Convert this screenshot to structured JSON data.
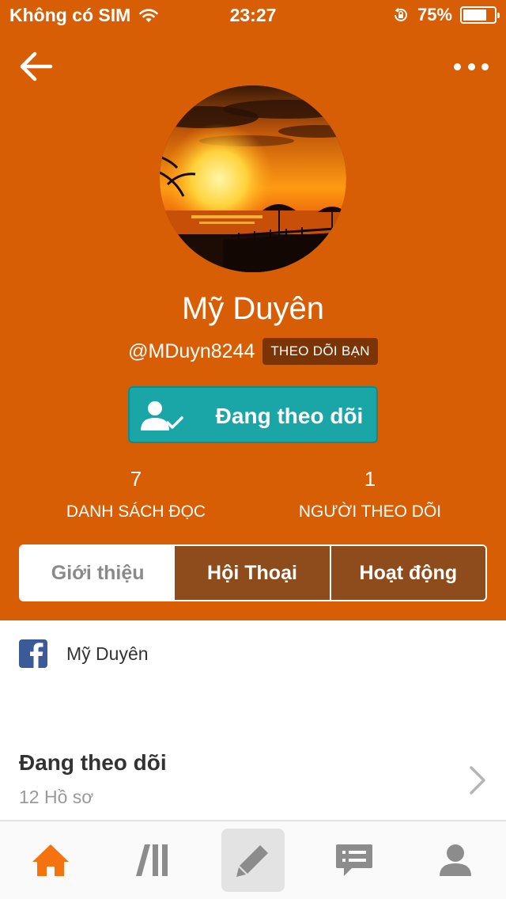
{
  "status_bar": {
    "carrier": "Không có SIM",
    "time": "23:27",
    "battery": "75%",
    "battery_level": 0.75
  },
  "icons": {
    "back": "arrow-left-icon",
    "more": "more-horizontal-icon",
    "wifi": "wifi-icon",
    "lock": "rotation-lock-icon",
    "battery": "battery-icon",
    "follow": "user-check-icon",
    "facebook": "facebook-icon",
    "chevron": "chevron-right-icon",
    "home": "home-icon",
    "library": "library-icon",
    "write": "pencil-icon",
    "messages": "messages-icon",
    "profile": "profile-icon"
  },
  "colors": {
    "header": "#d85e05",
    "follow_button": "#1aa6a6",
    "tab_active": "#ffffff",
    "tab_inactive": "#8e4b1c",
    "tabbar_active": "#f5730f",
    "tabbar_inactive": "#8c8c8c"
  },
  "profile": {
    "name": "Mỹ Duyên",
    "handle": "@MDuyn8244",
    "follows_you_badge": "THEO DÕI BẠN",
    "follow_button_label": "Đang theo dõi"
  },
  "stats": [
    {
      "value": "7",
      "label": "DANH SÁCH ĐỌC"
    },
    {
      "value": "1",
      "label": "NGƯỜI THEO DÕI"
    }
  ],
  "tabs": [
    {
      "label": "Giới thiệu",
      "selected": true
    },
    {
      "label": "Hội Thoại",
      "selected": false
    },
    {
      "label": "Hoạt động",
      "selected": false
    }
  ],
  "about": {
    "facebook_name": "Mỹ Duyên",
    "following_title": "Đang theo dõi",
    "following_count": "12 Hồ sơ"
  },
  "tabbar": {
    "active": "home"
  }
}
